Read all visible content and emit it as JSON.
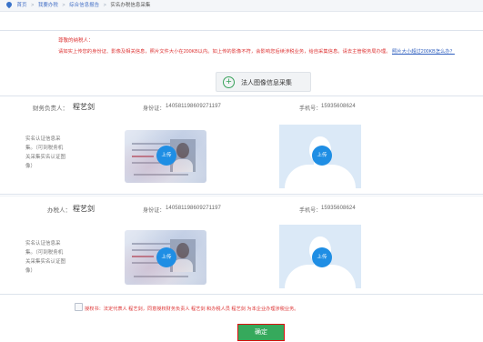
{
  "breadcrumb": {
    "items": [
      "首页",
      "我要办税",
      "综合信息报告",
      "实名办税信息采集"
    ],
    "separator": ">"
  },
  "notice": {
    "title": "尊敬的纳税人：",
    "body": "请如实上传您的身份证、影像及相关信息，照片文件大小在200KB以内。如上传的影像不符，会影响您后续涉税业务，给自采集信息。请去主管税务局办理。",
    "link": "照片大小超过200KB怎么办？"
  },
  "collect_button": {
    "label": "法人图像信息采集",
    "icon": "plus-circle-icon"
  },
  "finance_row": {
    "role_label": "财务负责人：",
    "name": "程艺剑",
    "id_label": "身份证：",
    "id_value": "140581198609271197",
    "phone_label": "手机号：",
    "phone_value": "15935608624"
  },
  "agent_row": {
    "role_label": "办税人：",
    "name": "程艺剑",
    "id_label": "身份证：",
    "id_value": "140581198609271197",
    "phone_label": "手机号：",
    "phone_value": "15935608624"
  },
  "realname_side_label": "实名认证信息采集。（可到税务机关采集实名认证图像）",
  "upload_label": "上传",
  "agreement": "授权书：法定代表人 程艺剑，同意授权财务负责人 程艺剑 和办税人员 程艺剑 为本企业办理涉税业务。",
  "confirm_label": "确定",
  "colors": {
    "accent_green": "#36a95c",
    "upload_blue": "#1f8ee4",
    "warning_red": "#d33333",
    "link_blue": "#2f5fbf"
  }
}
